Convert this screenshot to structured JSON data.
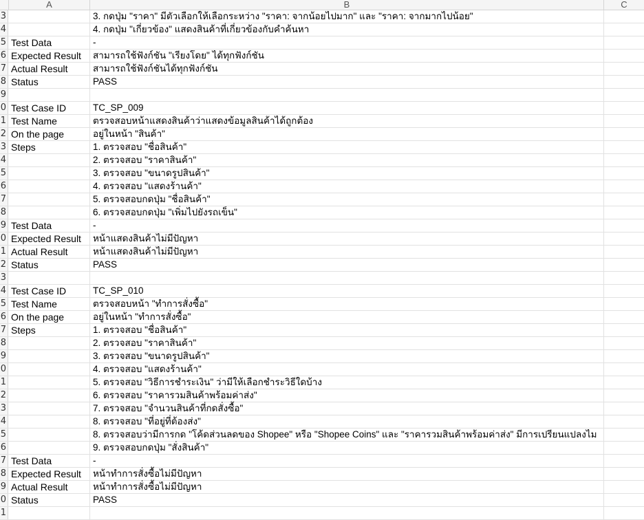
{
  "columns": [
    "A",
    "B",
    "C"
  ],
  "rows": [
    {
      "num": "3",
      "a": "",
      "b": "3. กดปุ่ม \"ราคา\" มีตัวเลือกให้เลือกระหว่าง \"ราคา: จากน้อยไปมาก\" และ \"ราคา: จากมากไปน้อย\""
    },
    {
      "num": "4",
      "a": "",
      "b": "4. กดปุ่ม \"เกี่ยวข้อง\" แสดงสินค้าที่เกี่ยวข้องกับคำค้นหา"
    },
    {
      "num": "5",
      "a": "Test Data",
      "b": "-"
    },
    {
      "num": "6",
      "a": "Expected Result",
      "b": "สามารถใช้ฟังก์ชัน \"เรียงโดย\" ได้ทุกฟังก์ชัน"
    },
    {
      "num": "7",
      "a": "Actual Result",
      "b": "สามารถใช้ฟังก์ชันได้ทุกฟังก์ชัน"
    },
    {
      "num": "8",
      "a": "Status",
      "b": "PASS"
    },
    {
      "num": "9",
      "a": "",
      "b": ""
    },
    {
      "num": "0",
      "a": "Test Case ID",
      "b": "TC_SP_009"
    },
    {
      "num": "1",
      "a": "Test Name",
      "b": "ตรวจสอบหน้าแสดงสินค้าว่าแสดงข้อมูลสินค้าได้ถูกต้อง"
    },
    {
      "num": "2",
      "a": "On the page",
      "b": "อยู่ในหน้า \"สินค้า\""
    },
    {
      "num": "3",
      "a": "Steps",
      "b": "1. ตรวจสอบ \"ชื่อสินค้า\""
    },
    {
      "num": "4",
      "a": "",
      "b": "2. ตรวจสอบ \"ราคาสินค้า\""
    },
    {
      "num": "5",
      "a": "",
      "b": "3. ตรวจสอบ \"ขนาดรูปสินค้า\""
    },
    {
      "num": "6",
      "a": "",
      "b": "4. ตรวจสอบ \"แสดงร้านค้า\""
    },
    {
      "num": "7",
      "a": "",
      "b": "5. ตรวจสอบกดปุ่ม \"ชื่อสินค้า\""
    },
    {
      "num": "8",
      "a": "",
      "b": "6. ตรวจสอบกดปุ่ม \"เพิ่มไปยังรถเข็น\""
    },
    {
      "num": "9",
      "a": "Test Data",
      "b": "-"
    },
    {
      "num": "0",
      "a": "Expected Result",
      "b": "หน้าแสดงสินค้าไม่มีปัญหา"
    },
    {
      "num": "1",
      "a": "Actual Result",
      "b": "หน้าแสดงสินค้าไม่มีปัญหา"
    },
    {
      "num": "2",
      "a": "Status",
      "b": "PASS"
    },
    {
      "num": "3",
      "a": "",
      "b": ""
    },
    {
      "num": "4",
      "a": "Test Case ID",
      "b": "TC_SP_010"
    },
    {
      "num": "5",
      "a": "Test Name",
      "b": "ตรวจสอบหน้า \"ทำการสั่งซื้อ\""
    },
    {
      "num": "6",
      "a": "On the page",
      "b": "อยู่ในหน้า \"ทำการสั่งซื้อ\""
    },
    {
      "num": "7",
      "a": "Steps",
      "b": "1. ตรวจสอบ \"ชื่อสินค้า\""
    },
    {
      "num": "8",
      "a": "",
      "b": "2. ตรวจสอบ \"ราคาสินค้า\""
    },
    {
      "num": "9",
      "a": "",
      "b": "3. ตรวจสอบ \"ขนาดรูปสินค้า\""
    },
    {
      "num": "0",
      "a": "",
      "b": "4. ตรวจสอบ \"แสดงร้านค้า\""
    },
    {
      "num": "1",
      "a": "",
      "b": "5. ตรวจสอบ \"วิธีการชำระเงิน\" ว่ามีให้เลือกชำระวิธีใดบ้าง"
    },
    {
      "num": "2",
      "a": "",
      "b": "6. ตรวจสอบ \"ราคารวมสินค้าพร้อมค่าส่ง\""
    },
    {
      "num": "3",
      "a": "",
      "b": "7. ตรวจสอบ \"จำนวนสินค้าที่กดสั่งซื้อ\""
    },
    {
      "num": "4",
      "a": "",
      "b": "8. ตรวจสอบ \"ที่อยู่ที่ต้องส่ง\""
    },
    {
      "num": "5",
      "a": "",
      "b": "8. ตรวจสอบว่ามีการกด \"โค้ดส่วนลดของ Shopee\" หรือ \"Shopee Coins\" และ \"ราคารวมสินค้าพร้อมค่าส่ง\" มีการเปรียนแปลงไม"
    },
    {
      "num": "6",
      "a": "",
      "b": "9. ตรวจสอบกดปุ่ม \"สั่งสินค้า\""
    },
    {
      "num": "7",
      "a": "Test Data",
      "b": "-"
    },
    {
      "num": "8",
      "a": "Expected Result",
      "b": "หน้าทำการสั่งซื้อไม่มีปัญหา"
    },
    {
      "num": "9",
      "a": "Actual Result",
      "b": "หน้าทำการสั่งซื้อไม่มีปัญหา"
    },
    {
      "num": "0",
      "a": "Status",
      "b": "PASS"
    },
    {
      "num": "1",
      "a": "",
      "b": ""
    }
  ]
}
